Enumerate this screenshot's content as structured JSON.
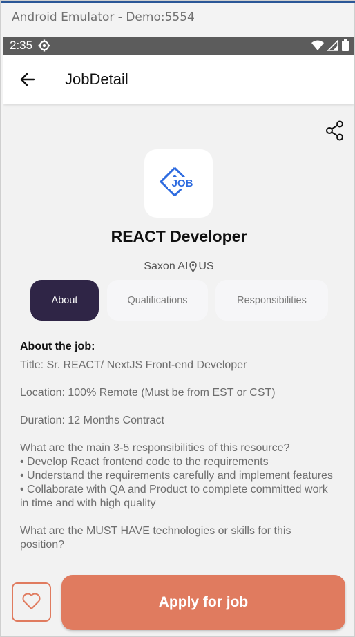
{
  "window": {
    "title": "Android Emulator - Demo:5554"
  },
  "status_bar": {
    "time": "2:35",
    "icons": [
      "settings-gear-icon",
      "wifi-icon",
      "signal-icon",
      "battery-icon"
    ]
  },
  "app_bar": {
    "title": "JobDetail",
    "back_icon": "arrow-left-icon"
  },
  "actions": {
    "share_icon": "share-icon"
  },
  "job": {
    "logo_text": "JOB",
    "title": "REACT Developer",
    "company": "Saxon AI",
    "location": "US"
  },
  "tabs": [
    {
      "label": "About",
      "active": true
    },
    {
      "label": "Qualifications",
      "active": false
    },
    {
      "label": "Responsibilities",
      "active": false
    }
  ],
  "about": {
    "heading": "About the job:",
    "paragraphs": [
      "Title: Sr. REACT/ NextJS Front-end Developer",
      "Location: 100% Remote (Must be from EST or CST)",
      "Duration: 12 Months Contract",
      "What are the main 3-5 responsibilities of this resource?\n• Develop React frontend code to the requirements\n• Understand the requirements carefully and implement features\n• Collaborate with QA and Product to complete committed work in time and with high quality",
      "What are the MUST HAVE technologies or skills for this position?"
    ]
  },
  "footer": {
    "apply_label": "Apply for job",
    "favorite_icon": "heart-icon"
  },
  "colors": {
    "accent": "#e07b5f",
    "tab_active_bg": "#2f2546",
    "logo_blue": "#2d6be0",
    "status_bar": "#5c5c5c"
  }
}
